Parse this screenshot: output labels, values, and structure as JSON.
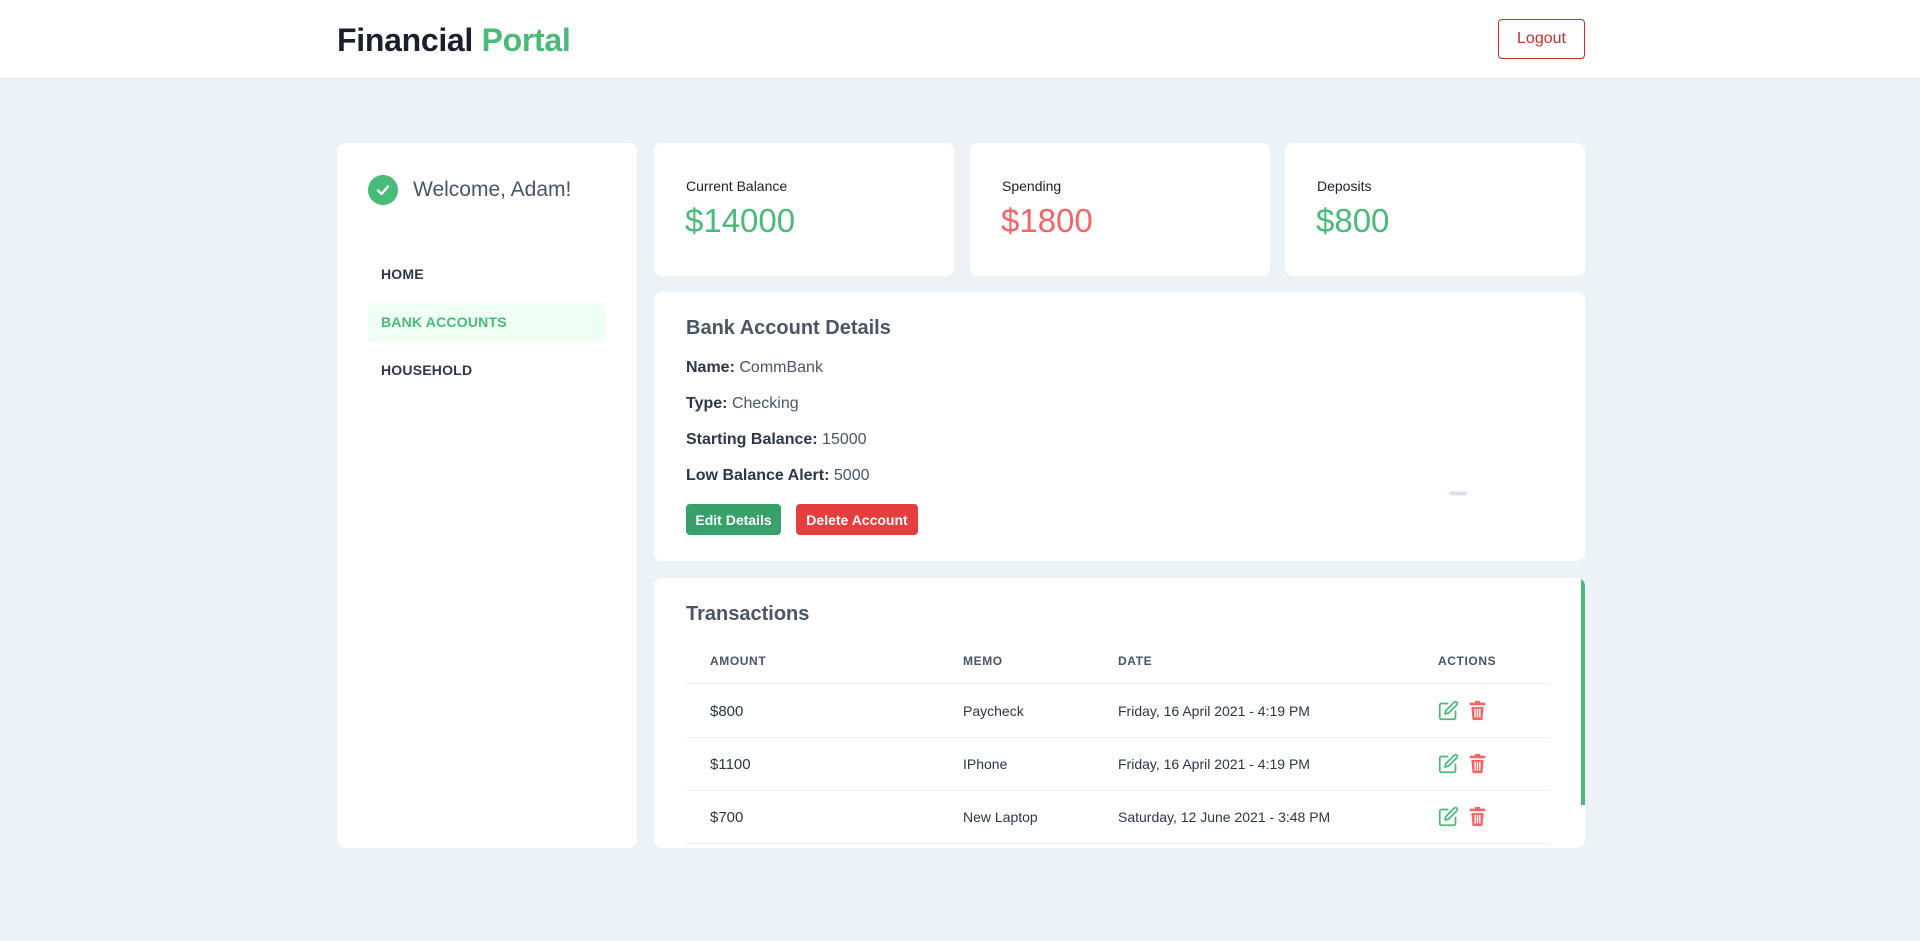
{
  "header": {
    "brand_part1": "Financial",
    "brand_part2": "Portal",
    "logout_label": "Logout"
  },
  "sidebar": {
    "welcome": "Welcome, Adam!",
    "items": [
      {
        "label": "HOME"
      },
      {
        "label": "BANK ACCOUNTS",
        "active": true
      },
      {
        "label": "HOUSEHOLD"
      }
    ]
  },
  "stats": {
    "balance": {
      "label": "Current Balance",
      "value": "$14000"
    },
    "spending": {
      "label": "Spending",
      "value": "$1800"
    },
    "deposits": {
      "label": "Deposits",
      "value": "$800"
    }
  },
  "details": {
    "title": "Bank Account Details",
    "name_label": "Name:",
    "name_value": "CommBank",
    "type_label": "Type:",
    "type_value": "Checking",
    "start_label": "Starting Balance:",
    "start_value": "15000",
    "low_label": "Low Balance Alert:",
    "low_value": "5000",
    "edit_label": "Edit Details",
    "delete_label": "Delete Account"
  },
  "transactions": {
    "title": "Transactions",
    "columns": [
      "AMOUNT",
      "MEMO",
      "DATE",
      "ACTIONS"
    ],
    "rows": [
      {
        "amount": "$800",
        "memo": "Paycheck",
        "date": "Friday, 16 April 2021 - 4:19 PM"
      },
      {
        "amount": "$1100",
        "memo": "IPhone",
        "date": "Friday, 16 April 2021 - 4:19 PM"
      },
      {
        "amount": "$700",
        "memo": "New Laptop",
        "date": "Saturday, 12 June 2021 - 3:48 PM"
      }
    ]
  },
  "colors": {
    "accent_green": "#48bb78",
    "danger_red": "#e53e3e",
    "negative_red": "#f56565",
    "background": "#edf2f7"
  },
  "icons": {
    "welcome": "check-circle-icon",
    "row_edit": "edit-icon",
    "row_delete": "trash-icon"
  }
}
